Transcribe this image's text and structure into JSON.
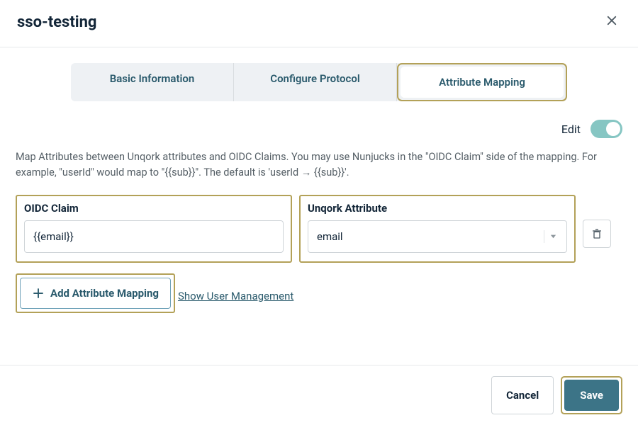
{
  "header": {
    "title": "sso-testing"
  },
  "tabs": {
    "basic": "Basic Information",
    "protocol": "Configure Protocol",
    "mapping": "Attribute Mapping"
  },
  "editRow": {
    "label": "Edit"
  },
  "description": "Map Attributes between Unqork attributes and OIDC Claims. You may use Nunjucks in the \"OIDC Claim\" side of the mapping. For example, \"userId\" would map to \"{{sub}}\". The default is 'userId → {{sub}}'.",
  "fields": {
    "oidc": {
      "label": "OIDC Claim",
      "value": "{{email}}"
    },
    "unqork": {
      "label": "Unqork Attribute",
      "value": "email"
    }
  },
  "addButton": "Add Attribute Mapping",
  "showLink": "Show User Management",
  "footer": {
    "cancel": "Cancel",
    "save": "Save"
  }
}
